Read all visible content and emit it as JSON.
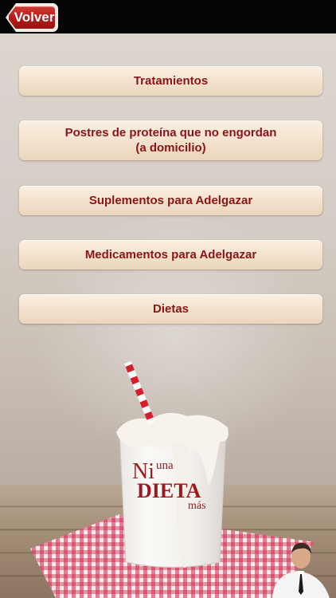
{
  "nav": {
    "back_label": "Volver"
  },
  "menu": {
    "items": [
      {
        "label": "Tratamientos"
      },
      {
        "label": "Postres de proteína que no engordan\n(a domicilio)"
      },
      {
        "label": "Suplementos para Adelgazar"
      },
      {
        "label": "Medicamentos para Adelgazar"
      },
      {
        "label": "Dietas"
      }
    ]
  },
  "illustration": {
    "logo_text": "Ni una DIETA más"
  },
  "colors": {
    "accent": "#b21d1a",
    "menu_text": "#8c1418",
    "menu_bg": "#f3e1cc",
    "topbar": "#050505"
  }
}
